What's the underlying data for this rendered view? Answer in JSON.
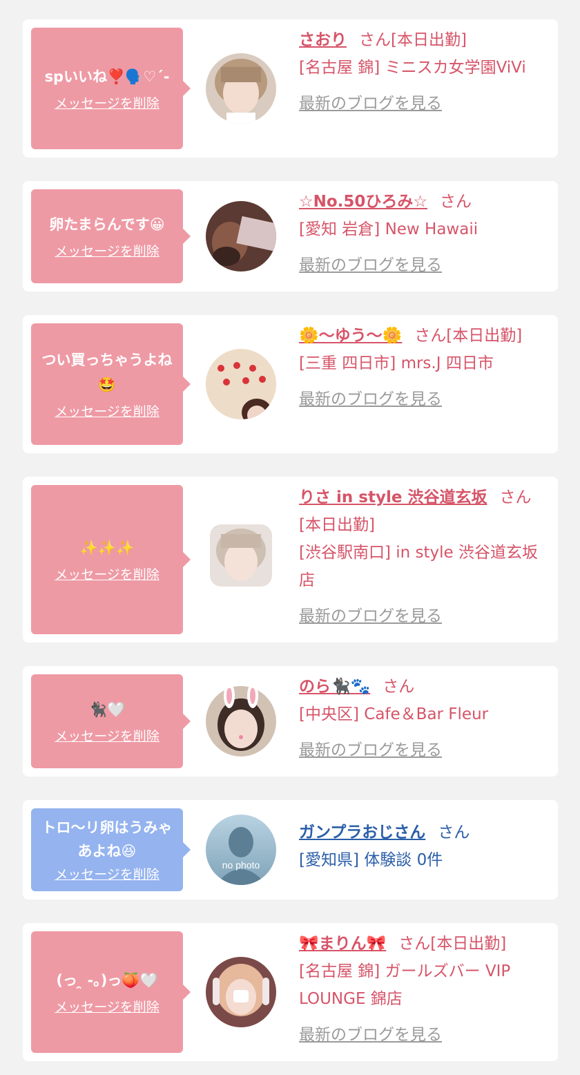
{
  "delete_label": "メッセージを削除",
  "blog_label": "最新のブログを見る",
  "colors": {
    "background": "#f2f2f2",
    "card": "#ffffff",
    "bubble_pink": "#ee9aa5",
    "bubble_blue": "#94b3ef",
    "text_pink": "#d65468",
    "text_blue": "#2a5ea8",
    "link_gray": "#9a9a9a"
  },
  "messages": [
    {
      "bubble": "spいいね❣️🗣️♡´-",
      "name": "さおり",
      "suffix": "さん[本日出勤]",
      "shop": "[名古屋 錦] ミニスカ女学園ViVi",
      "blog": true,
      "theme": "pink",
      "avatar": "photo"
    },
    {
      "bubble": "卵たまらんです😀",
      "name": "☆No.50ひろみ☆",
      "suffix": "さん",
      "shop": "[愛知 岩倉] New Hawaii",
      "blog": true,
      "theme": "pink",
      "avatar": "photo"
    },
    {
      "bubble": "つい買っちゃうよね🤩",
      "name": "🌼〜ゆう〜🌼",
      "suffix": "さん[本日出勤]",
      "shop": "[三重 四日市] mrs.J 四日市",
      "blog": true,
      "theme": "pink",
      "avatar": "photo"
    },
    {
      "bubble": "✨✨✨",
      "name": "りさ in style 渋谷道玄坂",
      "suffix": "さん[本日出勤]",
      "shop": "[渋谷駅南口] in style 渋谷道玄坂店",
      "blog": true,
      "theme": "pink",
      "avatar": "photo"
    },
    {
      "bubble": "🐈‍⬛🤍",
      "name": "のら🐈‍⬛🐾",
      "suffix": "さん",
      "shop": "[中央区] Cafe＆Bar Fleur",
      "blog": true,
      "theme": "pink",
      "avatar": "photo"
    },
    {
      "bubble": "トロ〜リ卵はうみゃあよね😆",
      "name": "ガンプラおじさん",
      "suffix": "さん",
      "shop": "[愛知県] 体験談 0件",
      "blog": false,
      "theme": "blue",
      "avatar": "no photo"
    },
    {
      "bubble": "(っ ̯ -｡)っ🍑🤍",
      "name": "🎀まりん🎀",
      "suffix": "さん[本日出勤]",
      "shop": "[名古屋 錦] ガールズバー VIP LOUNGE 錦店",
      "blog": true,
      "theme": "pink",
      "avatar": "photo"
    }
  ]
}
